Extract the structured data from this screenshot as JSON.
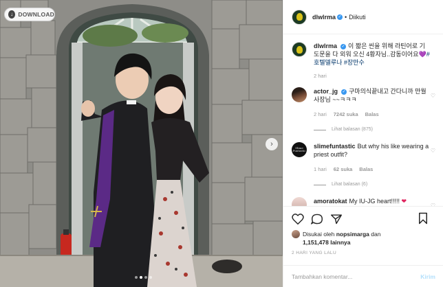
{
  "photo": {
    "download_label": "DOWNLOAD",
    "download_icon": "download-icon",
    "next_icon": "chevron-right-icon",
    "dots_count": 4,
    "active_dot": 1
  },
  "header": {
    "username": "dlwlrma",
    "separator": "•",
    "follow_label": "Diikuti"
  },
  "caption": {
    "username": "dlwlrma",
    "text": "이 짧은 씬을 위해 라틴어로 기도문을 다 외워 오신 4황자님..감동이어요💜",
    "hashtags": "#호텔델루나 #장만수",
    "time": "2 hari"
  },
  "comments": [
    {
      "username": "actor_jg",
      "text": "구마의식끝내고 간다니까 만월사장님 ~~ㅋㅋㅋ",
      "time": "2 hari",
      "likes": "7242 suka",
      "reply_label": "Balas",
      "view_replies": "Lihat balasan (875)"
    },
    {
      "username": "slimefuntastic",
      "text": "But why his like wearing a priest outfit?",
      "time": "1 hari",
      "likes": "62 suka",
      "reply_label": "Balas",
      "view_replies": "Lihat balasan (6)"
    },
    {
      "username": "amoratokat",
      "text": "My IU-JG heart!!!!!"
    }
  ],
  "likes": {
    "prefix": "Disukai oleh",
    "user": "nopsimarga",
    "joiner": "dan",
    "count": "1,151,478",
    "suffix": "lainnya"
  },
  "time_ago": "2 HARI YANG LALU",
  "composer": {
    "placeholder": "Tambahkan komentar...",
    "post_label": "Kirim"
  },
  "colors": {
    "link_blue": "#003569",
    "verified_blue": "#3897f0",
    "post_disabled": "#b2dffc",
    "muted": "#999999"
  }
}
